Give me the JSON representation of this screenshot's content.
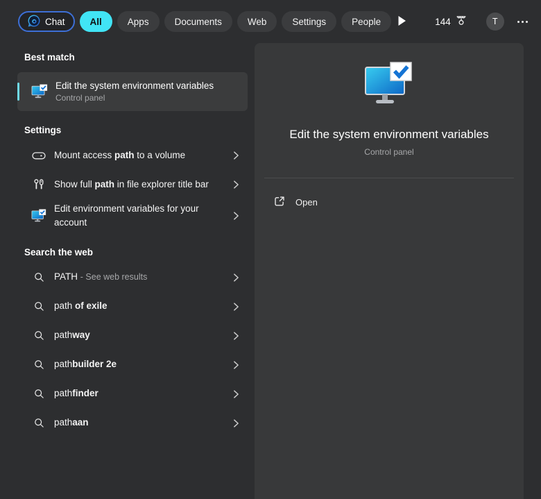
{
  "colors": {
    "all_pill": "#41e4f5",
    "accent_bar": "#6fd9e7",
    "chat_border": "#3d6fd6",
    "check_blue": "#1574d4"
  },
  "topbar": {
    "chat_label": "Chat",
    "tabs": [
      {
        "label": "All",
        "selected": true
      },
      {
        "label": "Apps"
      },
      {
        "label": "Documents"
      },
      {
        "label": "Web"
      },
      {
        "label": "Settings"
      },
      {
        "label": "People"
      }
    ],
    "rewards_count": "144",
    "avatar_initial": "T"
  },
  "best_match": {
    "header": "Best match",
    "title": "Edit the system environment variables",
    "subtitle": "Control panel",
    "icon": "system-env-monitor-icon"
  },
  "sections": [
    {
      "header": "Settings",
      "items": [
        {
          "icon": "drive-icon",
          "segments": [
            {
              "t": "Mount access "
            },
            {
              "t": "path",
              "b": true
            },
            {
              "t": " to a volume"
            }
          ]
        },
        {
          "icon": "tools-icon",
          "segments": [
            {
              "t": "Show full "
            },
            {
              "t": "path",
              "b": true
            },
            {
              "t": " in file explorer title bar"
            }
          ]
        },
        {
          "icon": "system-env-monitor-icon",
          "segments": [
            {
              "t": "Edit environment variables for your account"
            }
          ]
        }
      ]
    },
    {
      "header": "Search the web",
      "items": [
        {
          "icon": "search-icon",
          "segments": [
            {
              "t": "PATH "
            },
            {
              "t": "- See web results",
              "dim": true
            }
          ]
        },
        {
          "icon": "search-icon",
          "segments": [
            {
              "t": "path "
            },
            {
              "t": "of exile",
              "b": true
            }
          ]
        },
        {
          "icon": "search-icon",
          "segments": [
            {
              "t": "path"
            },
            {
              "t": "way",
              "b": true
            }
          ]
        },
        {
          "icon": "search-icon",
          "segments": [
            {
              "t": "path"
            },
            {
              "t": "builder 2e",
              "b": true
            }
          ]
        },
        {
          "icon": "search-icon",
          "segments": [
            {
              "t": "path"
            },
            {
              "t": "finder",
              "b": true
            }
          ]
        },
        {
          "icon": "search-icon",
          "segments": [
            {
              "t": "path"
            },
            {
              "t": "aan",
              "b": true
            }
          ]
        }
      ]
    }
  ],
  "preview": {
    "icon": "system-env-monitor-large-icon",
    "title": "Edit the system environment variables",
    "subtitle": "Control panel",
    "open_label": "Open",
    "open_icon": "open-external-icon"
  }
}
